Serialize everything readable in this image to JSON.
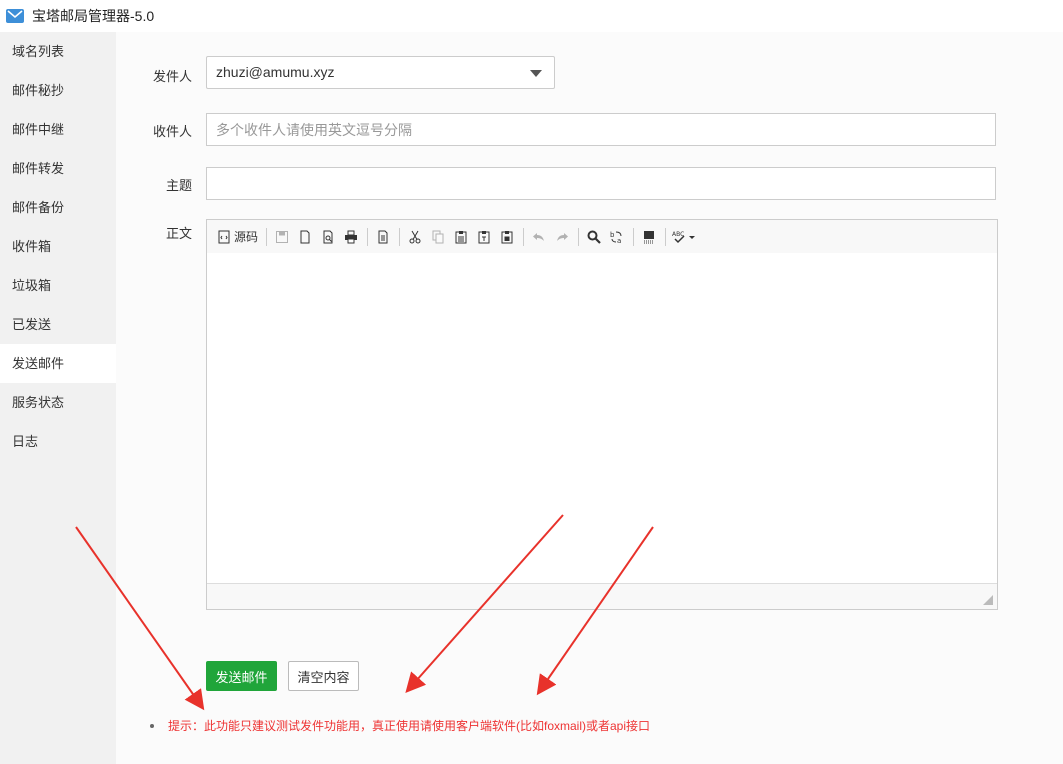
{
  "window": {
    "title": "宝塔邮局管理器-5.0"
  },
  "sidebar": {
    "items": [
      {
        "label": "域名列表"
      },
      {
        "label": "邮件秘抄"
      },
      {
        "label": "邮件中继"
      },
      {
        "label": "邮件转发"
      },
      {
        "label": "邮件备份"
      },
      {
        "label": "收件箱"
      },
      {
        "label": "垃圾箱"
      },
      {
        "label": "已发送"
      },
      {
        "label": "发送邮件",
        "active": true
      },
      {
        "label": "服务状态"
      },
      {
        "label": "日志"
      }
    ]
  },
  "form": {
    "sender_label": "发件人",
    "sender_value": "zhuzi@amumu.xyz",
    "recipient_label": "收件人",
    "recipient_placeholder": "多个收件人请使用英文逗号分隔",
    "subject_label": "主题",
    "subject_value": "",
    "body_label": "正文"
  },
  "editor": {
    "source_label": "源码",
    "toolbar_icons": [
      "source-icon",
      "save-icon",
      "new-page-icon",
      "preview-icon",
      "print-icon",
      "templates-icon",
      "cut-icon",
      "copy-icon",
      "paste-icon",
      "paste-text-icon",
      "paste-word-icon",
      "undo-icon",
      "redo-icon",
      "find-icon",
      "replace-icon",
      "select-all-icon",
      "spellcheck-icon"
    ]
  },
  "buttons": {
    "send_label": "发送邮件",
    "clear_label": "清空内容"
  },
  "tip": {
    "text": "提示：此功能只建议测试发件功能用，真正使用请使用客户端软件(比如foxmail)或者api接口"
  },
  "colors": {
    "accent_green": "#20a53a",
    "tip_red": "#e33333",
    "arrow_red": "#e8322b"
  }
}
